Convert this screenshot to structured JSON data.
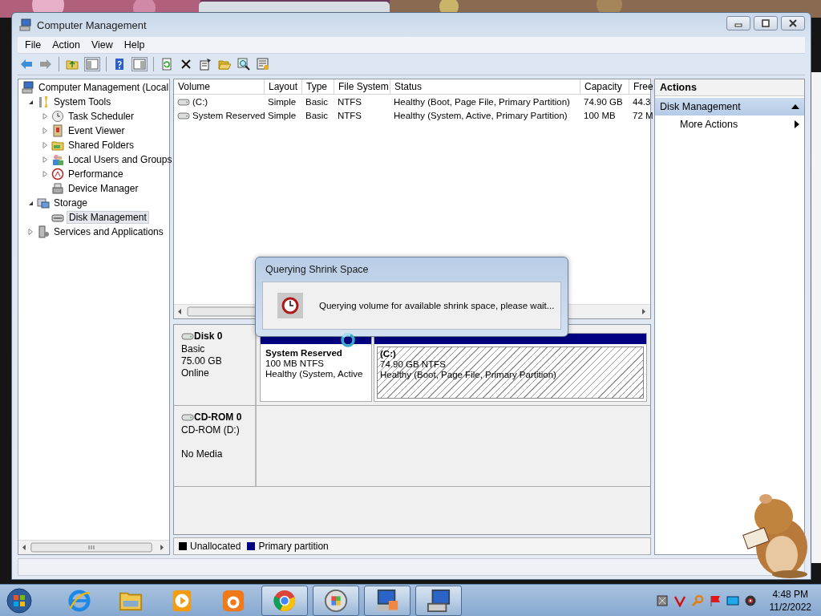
{
  "window": {
    "title": "Computer Management"
  },
  "menu": [
    "File",
    "Action",
    "View",
    "Help"
  ],
  "tree": [
    {
      "label": "Computer Management (Local",
      "selected": false,
      "children": [
        {
          "label": "System Tools",
          "kind": "group",
          "expanded": true,
          "selected": false,
          "children": [
            {
              "label": "Task Scheduler",
              "kind": "group",
              "expanded": false,
              "selected": false
            },
            {
              "label": "Event Viewer",
              "kind": "group",
              "expanded": false,
              "selected": false
            },
            {
              "label": "Shared Folders",
              "kind": "group",
              "expanded": false,
              "selected": false
            },
            {
              "label": "Local Users and Groups",
              "kind": "group",
              "expanded": false,
              "selected": false
            },
            {
              "label": "Performance",
              "kind": "group",
              "expanded": false,
              "selected": false
            },
            {
              "label": "Device Manager",
              "kind": "leaf",
              "selected": false
            }
          ]
        },
        {
          "label": "Storage",
          "kind": "group",
          "expanded": true,
          "selected": false,
          "children": [
            {
              "label": "Disk Management",
              "kind": "leaf",
              "selected": true
            }
          ]
        },
        {
          "label": "Services and Applications",
          "kind": "group",
          "expanded": false,
          "selected": false
        }
      ]
    }
  ],
  "table": {
    "columns": [
      "Volume",
      "Layout",
      "Type",
      "File System",
      "Status",
      "Capacity",
      "Free"
    ],
    "rows": [
      [
        "(C:)",
        "Simple",
        "Basic",
        "NTFS",
        "Healthy (Boot, Page File, Primary Partition)",
        "74.90 GB",
        "44.3"
      ],
      [
        "System Reserved",
        "Simple",
        "Basic",
        "NTFS",
        "Healthy (System, Active, Primary Partition)",
        "100 MB",
        "72 M"
      ]
    ]
  },
  "disks": [
    {
      "name": "Disk 0",
      "kind": "basic",
      "lines": [
        "Basic",
        "75.00 GB",
        "Online"
      ],
      "partitions": [
        {
          "name": "System Reserved",
          "size": "100 MB NTFS",
          "status": "Healthy (System, Active",
          "kind": "primary",
          "selected": false
        },
        {
          "name": "(C:)",
          "size": "74.90 GB NTFS",
          "status": "Healthy (Boot, Page File, Primary Partition)",
          "kind": "primary",
          "selected": true
        }
      ]
    },
    {
      "name": "CD-ROM 0",
      "kind": "cdrom",
      "lines": [
        "CD-ROM (D:)",
        "No Media"
      ]
    }
  ],
  "legend": [
    {
      "label": "Unallocated",
      "kind": "unallocated",
      "color": "#000000"
    },
    {
      "label": "Primary partition",
      "kind": "primary",
      "color": "#000080"
    }
  ],
  "actions": {
    "header": "Actions",
    "section": {
      "label": "Disk Management",
      "expanded": true
    },
    "items": [
      "More Actions"
    ]
  },
  "dialog": {
    "title": "Querying Shrink Space",
    "message": "Querying volume for available shrink space, please wait..."
  },
  "taskbar": {
    "items": [
      {
        "running": false
      },
      {
        "running": false
      },
      {
        "running": false
      },
      {
        "running": false
      },
      {
        "running": true
      },
      {
        "running": true
      },
      {
        "running": true
      },
      {
        "running": true
      }
    ],
    "time": "4:48 PM",
    "date": "11/2/2022"
  }
}
